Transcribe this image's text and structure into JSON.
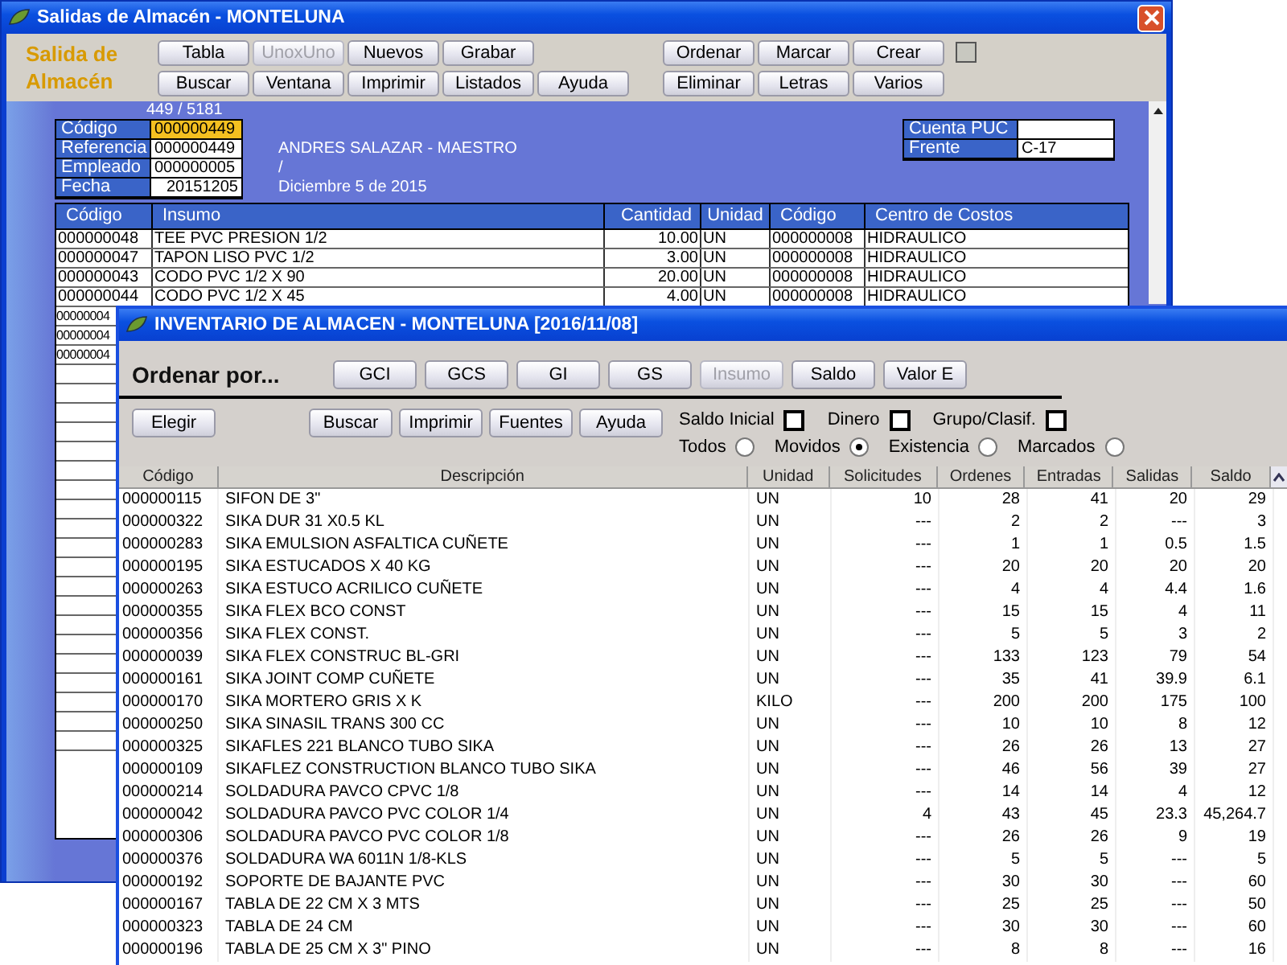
{
  "back_window": {
    "title": "Salidas de Almacén - MONTELUNA",
    "brand": "Salida de Almacén",
    "toolbar_left": [
      [
        {
          "label": "Tabla",
          "disabled": false
        },
        {
          "label": "UnoxUno",
          "disabled": true
        },
        {
          "label": "Nuevos",
          "disabled": false
        },
        {
          "label": "Grabar",
          "disabled": false
        }
      ],
      [
        {
          "label": "Buscar",
          "disabled": false
        },
        {
          "label": "Ventana",
          "disabled": false
        },
        {
          "label": "Imprimir",
          "disabled": false
        },
        {
          "label": "Listados",
          "disabled": false
        },
        {
          "label": "Ayuda",
          "disabled": false
        }
      ]
    ],
    "toolbar_right": [
      [
        {
          "label": "Ordenar",
          "disabled": false
        },
        {
          "label": "Marcar",
          "disabled": false
        },
        {
          "label": "Crear",
          "disabled": false
        }
      ],
      [
        {
          "label": "Eliminar",
          "disabled": false
        },
        {
          "label": "Letras",
          "disabled": false
        },
        {
          "label": "Varios",
          "disabled": false
        }
      ]
    ],
    "toolbar_checkbox": {
      "checked": false
    },
    "record_counter": "449 / 5181",
    "fields": [
      {
        "label": "Código",
        "value": "000000449",
        "focused": true,
        "kind": "text"
      },
      {
        "label": "Referencia",
        "value": "000000449",
        "focused": false,
        "kind": "text"
      },
      {
        "label": "Empleado",
        "value": "000000005",
        "focused": false,
        "kind": "text"
      },
      {
        "label": "Fecha",
        "value": "20151205",
        "focused": false,
        "kind": "date"
      }
    ],
    "info_lines": [
      "ANDRES SALAZAR - MAESTRO",
      "/",
      "Diciembre 5 de 2015"
    ],
    "side_fields": [
      {
        "label": "Cuenta PUC"
      },
      {
        "label": "Frente",
        "value": "C-17"
      }
    ],
    "table": {
      "columns": [
        "Código",
        "Insumo",
        "Cantidad",
        "Unidad",
        "Código",
        "Centro de Costos"
      ],
      "rows": [
        [
          "000000048",
          "TEE PVC PRESION 1/2",
          "10.00",
          "UN",
          "000000008",
          "HIDRAULICO"
        ],
        [
          "000000047",
          "TAPON LISO PVC 1/2",
          "3.00",
          "UN",
          "000000008",
          "HIDRAULICO"
        ],
        [
          "000000043",
          "CODO PVC 1/2 X 90",
          "20.00",
          "UN",
          "000000008",
          "HIDRAULICO"
        ],
        [
          "000000044",
          "CODO PVC 1/2 X 45",
          "4.00",
          "UN",
          "000000008",
          "HIDRAULICO"
        ],
        [
          "00000004"
        ],
        [
          "00000004"
        ],
        [
          "00000004"
        ]
      ]
    }
  },
  "front_window": {
    "title": "INVENTARIO DE ALMACEN - MONTELUNA [2016/11/08]",
    "sort_label": "Ordenar por...",
    "sort_buttons": [
      {
        "label": "GCI",
        "disabled": false
      },
      {
        "label": "GCS",
        "disabled": false
      },
      {
        "label": "GI",
        "disabled": false
      },
      {
        "label": "GS",
        "disabled": false
      },
      {
        "label": "Insumo",
        "disabled": true
      },
      {
        "label": "Saldo",
        "disabled": false
      },
      {
        "label": "Valor E",
        "disabled": false
      }
    ],
    "choose_button": "Elegir",
    "action_buttons": [
      "Buscar",
      "Imprimir",
      "Fuentes",
      "Ayuda"
    ],
    "checkboxes": [
      {
        "label": "Saldo Inicial",
        "checked": false
      },
      {
        "label": "Dinero",
        "checked": false
      },
      {
        "label": "Grupo/Clasif.",
        "checked": false
      }
    ],
    "radios": [
      {
        "label": "Todos",
        "selected": false
      },
      {
        "label": "Movidos",
        "selected": true
      },
      {
        "label": "Existencia",
        "selected": false
      },
      {
        "label": "Marcados",
        "selected": false
      }
    ],
    "table": {
      "columns": [
        "Código",
        "Descripción",
        "Unidad",
        "Solicitudes",
        "Ordenes",
        "Entradas",
        "Salidas",
        "Saldo"
      ],
      "rows": [
        [
          "000000115",
          "SIFON DE 3\"",
          "UN",
          "10",
          "28",
          "41",
          "20",
          "29"
        ],
        [
          "000000322",
          "SIKA DUR 31 X0.5 KL",
          "UN",
          "---",
          "2",
          "2",
          "---",
          "3"
        ],
        [
          "000000283",
          "SIKA EMULSION ASFALTICA CUÑETE",
          "UN",
          "---",
          "1",
          "1",
          "0.5",
          "1.5"
        ],
        [
          "000000195",
          "SIKA ESTUCADOS X 40 KG",
          "UN",
          "---",
          "20",
          "20",
          "20",
          "20"
        ],
        [
          "000000263",
          "SIKA ESTUCO ACRILICO CUÑETE",
          "UN",
          "---",
          "4",
          "4",
          "4.4",
          "1.6"
        ],
        [
          "000000355",
          "SIKA FLEX BCO CONST",
          "UN",
          "---",
          "15",
          "15",
          "4",
          "11"
        ],
        [
          "000000356",
          "SIKA FLEX CONST.",
          "UN",
          "---",
          "5",
          "5",
          "3",
          "2"
        ],
        [
          "000000039",
          "SIKA FLEX CONSTRUC BL-GRI",
          "UN",
          "---",
          "133",
          "123",
          "79",
          "54"
        ],
        [
          "000000161",
          "SIKA JOINT COMP CUÑETE",
          "UN",
          "---",
          "35",
          "41",
          "39.9",
          "6.1"
        ],
        [
          "000000170",
          "SIKA MORTERO GRIS X K",
          "KILO",
          "---",
          "200",
          "200",
          "175",
          "100"
        ],
        [
          "000000250",
          "SIKA SINASIL TRANS 300 CC",
          "UN",
          "---",
          "10",
          "10",
          "8",
          "12"
        ],
        [
          "000000325",
          "SIKAFLES 221 BLANCO TUBO SIKA",
          "UN",
          "---",
          "26",
          "26",
          "13",
          "27"
        ],
        [
          "000000109",
          "SIKAFLEZ CONSTRUCTION BLANCO TUBO SIKA",
          "UN",
          "---",
          "46",
          "56",
          "39",
          "27"
        ],
        [
          "000000214",
          "SOLDADURA PAVCO CPVC 1/8",
          "UN",
          "---",
          "14",
          "14",
          "4",
          "12"
        ],
        [
          "000000042",
          "SOLDADURA PAVCO PVC COLOR 1/4",
          "UN",
          "4",
          "43",
          "45",
          "23.3",
          "45,264.7"
        ],
        [
          "000000306",
          "SOLDADURA PAVCO PVC COLOR 1/8",
          "UN",
          "---",
          "26",
          "26",
          "9",
          "19"
        ],
        [
          "000000376",
          "SOLDADURA WA  6011N 1/8-KLS",
          "UN",
          "---",
          "5",
          "5",
          "---",
          "5"
        ],
        [
          "000000192",
          "SOPORTE DE BAJANTE PVC",
          "UN",
          "---",
          "30",
          "30",
          "---",
          "60"
        ],
        [
          "000000167",
          "TABLA DE 22 CM X 3  MTS",
          "UN",
          "---",
          "25",
          "25",
          "---",
          "50"
        ],
        [
          "000000323",
          "TABLA DE 24 CM",
          "UN",
          "---",
          "30",
          "30",
          "---",
          "60"
        ],
        [
          "000000196",
          "TABLA DE 25 CM X 3\"  PINO",
          "UN",
          "---",
          "8",
          "8",
          "---",
          "16"
        ]
      ]
    }
  }
}
